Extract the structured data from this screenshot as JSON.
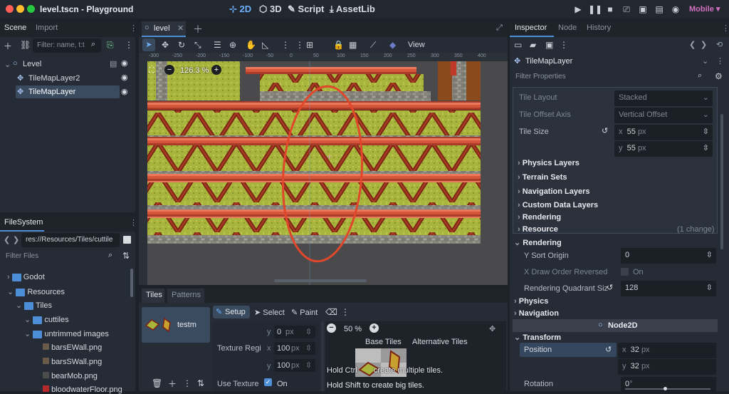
{
  "window": {
    "title": "level.tscn - Playground"
  },
  "modes": {
    "m2d": "2D",
    "m3d": "3D",
    "script": "Script",
    "assetlib": "AssetLib"
  },
  "renderer": "Mobile",
  "scene": {
    "tab_scene": "Scene",
    "tab_import": "Import",
    "filter_placeholder": "Filter: name, t:t",
    "nodes": [
      {
        "label": "Level"
      },
      {
        "label": "TileMapLayer2"
      },
      {
        "label": "TileMapLayer"
      }
    ]
  },
  "filesystem": {
    "tab": "FileSystem",
    "path": "res://Resources/Tiles/cuttile",
    "filter_placeholder": "Filter Files",
    "items": [
      "Godot",
      "Resources",
      "Tiles",
      "cuttiles",
      "untrimmed images",
      "barsEWall.png",
      "barsSWall.png",
      "bearMob.png",
      "bloodwaterFloor.png"
    ]
  },
  "editor": {
    "tab": "level",
    "zoom": "126.3 %",
    "view": "View",
    "ruler_labels": [
      "-300",
      "-250",
      "-200",
      "-150",
      "-100",
      "-50",
      "0",
      "50",
      "100",
      "150",
      "200",
      "250",
      "300",
      "350",
      "400"
    ]
  },
  "tiles": {
    "tab_tiles": "Tiles",
    "tab_patterns": "Patterns",
    "source": "testm",
    "setup": "Setup",
    "select": "Select",
    "paint": "Paint",
    "y_top": "0",
    "px": "px",
    "texture_region": "Texture Regi",
    "x_val": "100",
    "y_val": "100",
    "use_texture": "Use Texture",
    "on": "On",
    "zoom": "50 %",
    "base_tiles": "Base Tiles",
    "alt_tiles": "Alternative Tiles",
    "hint1_a": "Hold Ctrl",
    "hint1_b": "create multiple tiles.",
    "hint2": "Hold Shift to create big tiles."
  },
  "inspector": {
    "tab_inspector": "Inspector",
    "tab_node": "Node",
    "tab_history": "History",
    "node": "TileMapLayer",
    "filter": "Filter Properties",
    "tile_layout": "Tile Layout",
    "tile_layout_val": "Stacked",
    "tile_offset_axis": "Tile Offset Axis",
    "tile_offset_val": "Vertical Offset",
    "tile_size": "Tile Size",
    "x": "x",
    "y": "y",
    "tile_w": "55",
    "tile_h": "55",
    "px": "px",
    "physics_layers": "Physics Layers",
    "terrain_sets": "Terrain Sets",
    "navigation_layers": "Navigation Layers",
    "custom_data": "Custom Data Layers",
    "rendering_sub": "Rendering",
    "resource": "Resource",
    "one_change": "(1 change)",
    "rendering": "Rendering",
    "y_sort_origin": "Y Sort Origin",
    "y_sort_val": "0",
    "x_draw": "X Draw Order Reversed",
    "on": "On",
    "quadrant": "Rendering Quadrant Siz",
    "quadrant_val": "128",
    "physics": "Physics",
    "navigation": "Navigation",
    "node2d": "Node2D",
    "transform": "Transform",
    "position": "Position",
    "pos_x": "32",
    "pos_y": "32",
    "rotation": "Rotation",
    "rot_val": "0"
  },
  "colors": {
    "accent": "#4f8fd6",
    "circle": "#e0472b"
  }
}
